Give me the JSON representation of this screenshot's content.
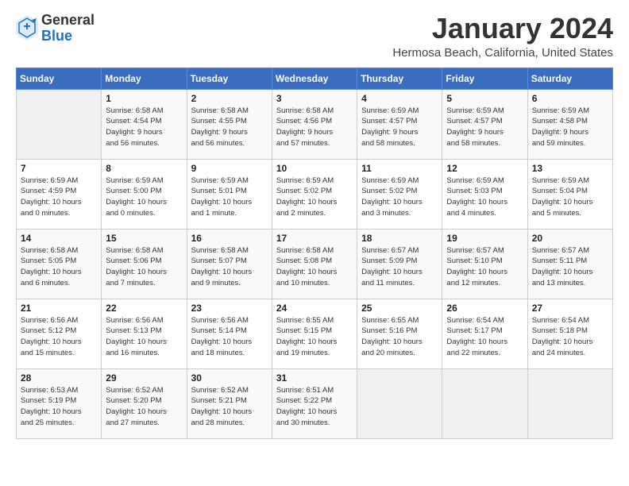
{
  "logo": {
    "general": "General",
    "blue": "Blue"
  },
  "title": "January 2024",
  "location": "Hermosa Beach, California, United States",
  "days_of_week": [
    "Sunday",
    "Monday",
    "Tuesday",
    "Wednesday",
    "Thursday",
    "Friday",
    "Saturday"
  ],
  "weeks": [
    [
      {
        "day": "",
        "info": ""
      },
      {
        "day": "1",
        "info": "Sunrise: 6:58 AM\nSunset: 4:54 PM\nDaylight: 9 hours\nand 56 minutes."
      },
      {
        "day": "2",
        "info": "Sunrise: 6:58 AM\nSunset: 4:55 PM\nDaylight: 9 hours\nand 56 minutes."
      },
      {
        "day": "3",
        "info": "Sunrise: 6:58 AM\nSunset: 4:56 PM\nDaylight: 9 hours\nand 57 minutes."
      },
      {
        "day": "4",
        "info": "Sunrise: 6:59 AM\nSunset: 4:57 PM\nDaylight: 9 hours\nand 58 minutes."
      },
      {
        "day": "5",
        "info": "Sunrise: 6:59 AM\nSunset: 4:57 PM\nDaylight: 9 hours\nand 58 minutes."
      },
      {
        "day": "6",
        "info": "Sunrise: 6:59 AM\nSunset: 4:58 PM\nDaylight: 9 hours\nand 59 minutes."
      }
    ],
    [
      {
        "day": "7",
        "info": "Sunrise: 6:59 AM\nSunset: 4:59 PM\nDaylight: 10 hours\nand 0 minutes."
      },
      {
        "day": "8",
        "info": "Sunrise: 6:59 AM\nSunset: 5:00 PM\nDaylight: 10 hours\nand 0 minutes."
      },
      {
        "day": "9",
        "info": "Sunrise: 6:59 AM\nSunset: 5:01 PM\nDaylight: 10 hours\nand 1 minute."
      },
      {
        "day": "10",
        "info": "Sunrise: 6:59 AM\nSunset: 5:02 PM\nDaylight: 10 hours\nand 2 minutes."
      },
      {
        "day": "11",
        "info": "Sunrise: 6:59 AM\nSunset: 5:02 PM\nDaylight: 10 hours\nand 3 minutes."
      },
      {
        "day": "12",
        "info": "Sunrise: 6:59 AM\nSunset: 5:03 PM\nDaylight: 10 hours\nand 4 minutes."
      },
      {
        "day": "13",
        "info": "Sunrise: 6:59 AM\nSunset: 5:04 PM\nDaylight: 10 hours\nand 5 minutes."
      }
    ],
    [
      {
        "day": "14",
        "info": "Sunrise: 6:58 AM\nSunset: 5:05 PM\nDaylight: 10 hours\nand 6 minutes."
      },
      {
        "day": "15",
        "info": "Sunrise: 6:58 AM\nSunset: 5:06 PM\nDaylight: 10 hours\nand 7 minutes."
      },
      {
        "day": "16",
        "info": "Sunrise: 6:58 AM\nSunset: 5:07 PM\nDaylight: 10 hours\nand 9 minutes."
      },
      {
        "day": "17",
        "info": "Sunrise: 6:58 AM\nSunset: 5:08 PM\nDaylight: 10 hours\nand 10 minutes."
      },
      {
        "day": "18",
        "info": "Sunrise: 6:57 AM\nSunset: 5:09 PM\nDaylight: 10 hours\nand 11 minutes."
      },
      {
        "day": "19",
        "info": "Sunrise: 6:57 AM\nSunset: 5:10 PM\nDaylight: 10 hours\nand 12 minutes."
      },
      {
        "day": "20",
        "info": "Sunrise: 6:57 AM\nSunset: 5:11 PM\nDaylight: 10 hours\nand 13 minutes."
      }
    ],
    [
      {
        "day": "21",
        "info": "Sunrise: 6:56 AM\nSunset: 5:12 PM\nDaylight: 10 hours\nand 15 minutes."
      },
      {
        "day": "22",
        "info": "Sunrise: 6:56 AM\nSunset: 5:13 PM\nDaylight: 10 hours\nand 16 minutes."
      },
      {
        "day": "23",
        "info": "Sunrise: 6:56 AM\nSunset: 5:14 PM\nDaylight: 10 hours\nand 18 minutes."
      },
      {
        "day": "24",
        "info": "Sunrise: 6:55 AM\nSunset: 5:15 PM\nDaylight: 10 hours\nand 19 minutes."
      },
      {
        "day": "25",
        "info": "Sunrise: 6:55 AM\nSunset: 5:16 PM\nDaylight: 10 hours\nand 20 minutes."
      },
      {
        "day": "26",
        "info": "Sunrise: 6:54 AM\nSunset: 5:17 PM\nDaylight: 10 hours\nand 22 minutes."
      },
      {
        "day": "27",
        "info": "Sunrise: 6:54 AM\nSunset: 5:18 PM\nDaylight: 10 hours\nand 24 minutes."
      }
    ],
    [
      {
        "day": "28",
        "info": "Sunrise: 6:53 AM\nSunset: 5:19 PM\nDaylight: 10 hours\nand 25 minutes."
      },
      {
        "day": "29",
        "info": "Sunrise: 6:52 AM\nSunset: 5:20 PM\nDaylight: 10 hours\nand 27 minutes."
      },
      {
        "day": "30",
        "info": "Sunrise: 6:52 AM\nSunset: 5:21 PM\nDaylight: 10 hours\nand 28 minutes."
      },
      {
        "day": "31",
        "info": "Sunrise: 6:51 AM\nSunset: 5:22 PM\nDaylight: 10 hours\nand 30 minutes."
      },
      {
        "day": "",
        "info": ""
      },
      {
        "day": "",
        "info": ""
      },
      {
        "day": "",
        "info": ""
      }
    ]
  ]
}
